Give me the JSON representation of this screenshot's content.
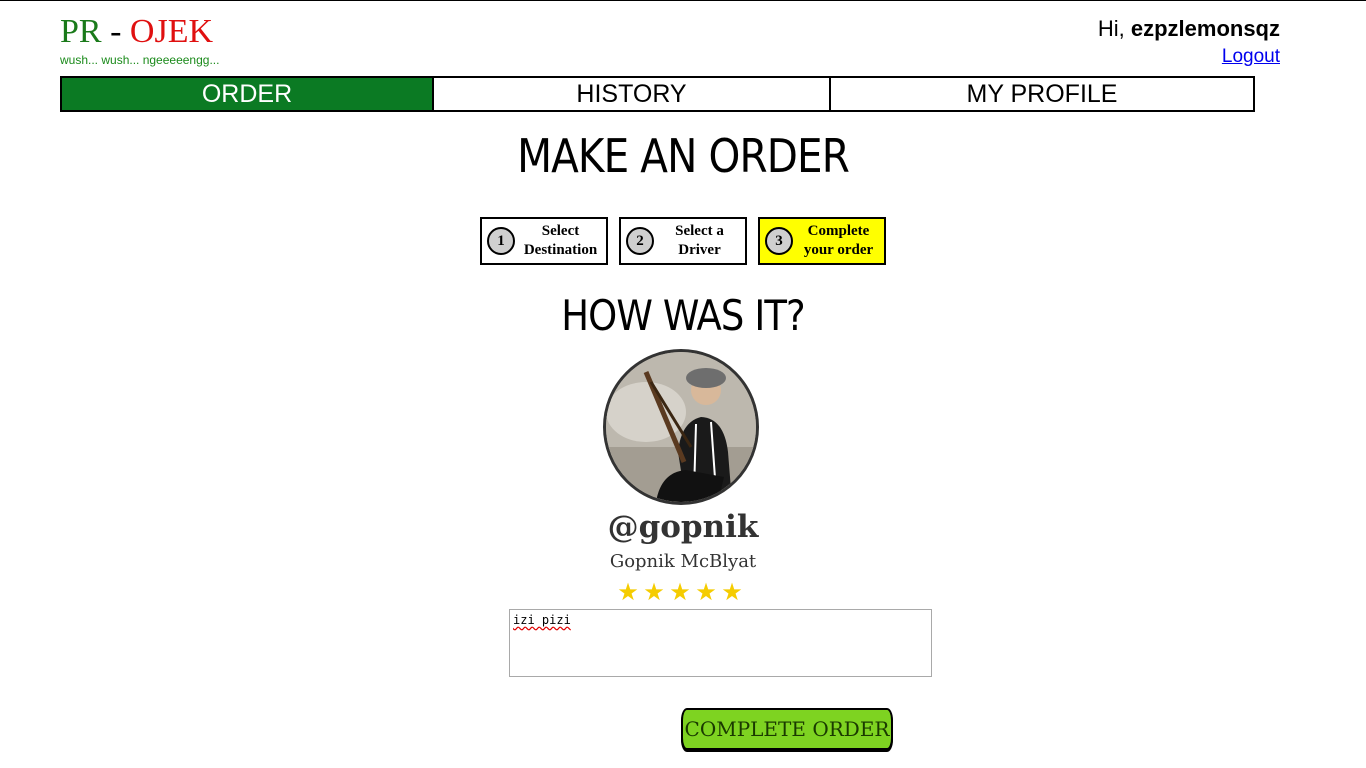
{
  "app": {
    "logo_pr": "PR",
    "logo_dash": " - ",
    "logo_ojek": "OJEK",
    "tagline": "wush... wush... ngeeeeengg..."
  },
  "user": {
    "greeting_prefix": "Hi, ",
    "username": "ezpzlemonsqz",
    "logout_label": "Logout"
  },
  "nav": {
    "tabs": [
      {
        "label": "ORDER",
        "active": true
      },
      {
        "label": "HISTORY",
        "active": false
      },
      {
        "label": "MY PROFILE",
        "active": false
      }
    ]
  },
  "page": {
    "title": "MAKE AN ORDER"
  },
  "steps": [
    {
      "number": "1",
      "label_line1": "Select",
      "label_line2": "Destination",
      "active": false
    },
    {
      "number": "2",
      "label_line1": "Select a",
      "label_line2": "Driver",
      "active": false
    },
    {
      "number": "3",
      "label_line1": "Complete",
      "label_line2": "your order",
      "active": true
    }
  ],
  "review": {
    "title": "HOW WAS IT?",
    "driver_username": "@gopnik",
    "driver_name": "Gopnik McBlyat",
    "rating": 5,
    "rating_max": 5,
    "comment": "izi pizi",
    "submit_label": "COMPLETE ORDER"
  },
  "colors": {
    "nav_active": "#0b7a23",
    "step_active": "#ffff00",
    "star": "#f5cc00",
    "button": "#7ed321"
  }
}
